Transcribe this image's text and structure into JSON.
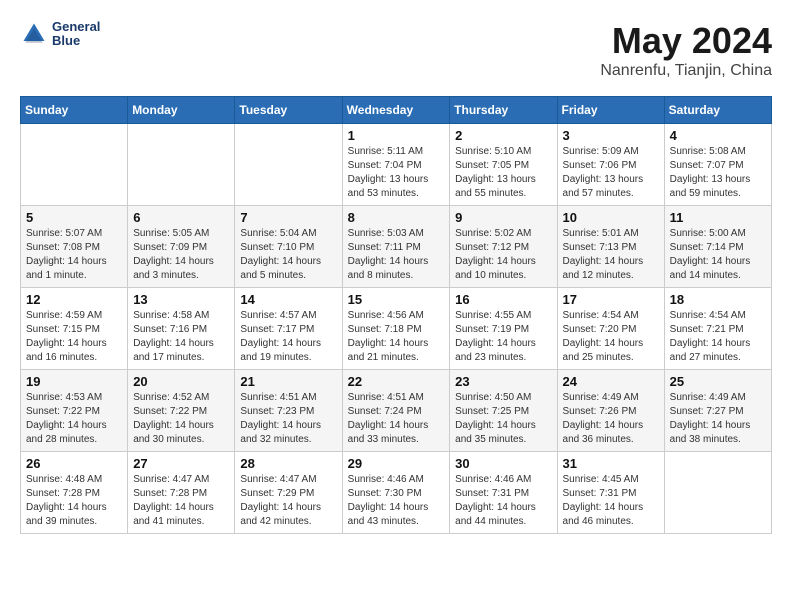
{
  "header": {
    "logo_line1": "General",
    "logo_line2": "Blue",
    "month": "May 2024",
    "location": "Nanrenfu, Tianjin, China"
  },
  "weekdays": [
    "Sunday",
    "Monday",
    "Tuesday",
    "Wednesday",
    "Thursday",
    "Friday",
    "Saturday"
  ],
  "weeks": [
    [
      {
        "day": "",
        "info": ""
      },
      {
        "day": "",
        "info": ""
      },
      {
        "day": "",
        "info": ""
      },
      {
        "day": "1",
        "info": "Sunrise: 5:11 AM\nSunset: 7:04 PM\nDaylight: 13 hours\nand 53 minutes."
      },
      {
        "day": "2",
        "info": "Sunrise: 5:10 AM\nSunset: 7:05 PM\nDaylight: 13 hours\nand 55 minutes."
      },
      {
        "day": "3",
        "info": "Sunrise: 5:09 AM\nSunset: 7:06 PM\nDaylight: 13 hours\nand 57 minutes."
      },
      {
        "day": "4",
        "info": "Sunrise: 5:08 AM\nSunset: 7:07 PM\nDaylight: 13 hours\nand 59 minutes."
      }
    ],
    [
      {
        "day": "5",
        "info": "Sunrise: 5:07 AM\nSunset: 7:08 PM\nDaylight: 14 hours\nand 1 minute."
      },
      {
        "day": "6",
        "info": "Sunrise: 5:05 AM\nSunset: 7:09 PM\nDaylight: 14 hours\nand 3 minutes."
      },
      {
        "day": "7",
        "info": "Sunrise: 5:04 AM\nSunset: 7:10 PM\nDaylight: 14 hours\nand 5 minutes."
      },
      {
        "day": "8",
        "info": "Sunrise: 5:03 AM\nSunset: 7:11 PM\nDaylight: 14 hours\nand 8 minutes."
      },
      {
        "day": "9",
        "info": "Sunrise: 5:02 AM\nSunset: 7:12 PM\nDaylight: 14 hours\nand 10 minutes."
      },
      {
        "day": "10",
        "info": "Sunrise: 5:01 AM\nSunset: 7:13 PM\nDaylight: 14 hours\nand 12 minutes."
      },
      {
        "day": "11",
        "info": "Sunrise: 5:00 AM\nSunset: 7:14 PM\nDaylight: 14 hours\nand 14 minutes."
      }
    ],
    [
      {
        "day": "12",
        "info": "Sunrise: 4:59 AM\nSunset: 7:15 PM\nDaylight: 14 hours\nand 16 minutes."
      },
      {
        "day": "13",
        "info": "Sunrise: 4:58 AM\nSunset: 7:16 PM\nDaylight: 14 hours\nand 17 minutes."
      },
      {
        "day": "14",
        "info": "Sunrise: 4:57 AM\nSunset: 7:17 PM\nDaylight: 14 hours\nand 19 minutes."
      },
      {
        "day": "15",
        "info": "Sunrise: 4:56 AM\nSunset: 7:18 PM\nDaylight: 14 hours\nand 21 minutes."
      },
      {
        "day": "16",
        "info": "Sunrise: 4:55 AM\nSunset: 7:19 PM\nDaylight: 14 hours\nand 23 minutes."
      },
      {
        "day": "17",
        "info": "Sunrise: 4:54 AM\nSunset: 7:20 PM\nDaylight: 14 hours\nand 25 minutes."
      },
      {
        "day": "18",
        "info": "Sunrise: 4:54 AM\nSunset: 7:21 PM\nDaylight: 14 hours\nand 27 minutes."
      }
    ],
    [
      {
        "day": "19",
        "info": "Sunrise: 4:53 AM\nSunset: 7:22 PM\nDaylight: 14 hours\nand 28 minutes."
      },
      {
        "day": "20",
        "info": "Sunrise: 4:52 AM\nSunset: 7:22 PM\nDaylight: 14 hours\nand 30 minutes."
      },
      {
        "day": "21",
        "info": "Sunrise: 4:51 AM\nSunset: 7:23 PM\nDaylight: 14 hours\nand 32 minutes."
      },
      {
        "day": "22",
        "info": "Sunrise: 4:51 AM\nSunset: 7:24 PM\nDaylight: 14 hours\nand 33 minutes."
      },
      {
        "day": "23",
        "info": "Sunrise: 4:50 AM\nSunset: 7:25 PM\nDaylight: 14 hours\nand 35 minutes."
      },
      {
        "day": "24",
        "info": "Sunrise: 4:49 AM\nSunset: 7:26 PM\nDaylight: 14 hours\nand 36 minutes."
      },
      {
        "day": "25",
        "info": "Sunrise: 4:49 AM\nSunset: 7:27 PM\nDaylight: 14 hours\nand 38 minutes."
      }
    ],
    [
      {
        "day": "26",
        "info": "Sunrise: 4:48 AM\nSunset: 7:28 PM\nDaylight: 14 hours\nand 39 minutes."
      },
      {
        "day": "27",
        "info": "Sunrise: 4:47 AM\nSunset: 7:28 PM\nDaylight: 14 hours\nand 41 minutes."
      },
      {
        "day": "28",
        "info": "Sunrise: 4:47 AM\nSunset: 7:29 PM\nDaylight: 14 hours\nand 42 minutes."
      },
      {
        "day": "29",
        "info": "Sunrise: 4:46 AM\nSunset: 7:30 PM\nDaylight: 14 hours\nand 43 minutes."
      },
      {
        "day": "30",
        "info": "Sunrise: 4:46 AM\nSunset: 7:31 PM\nDaylight: 14 hours\nand 44 minutes."
      },
      {
        "day": "31",
        "info": "Sunrise: 4:45 AM\nSunset: 7:31 PM\nDaylight: 14 hours\nand 46 minutes."
      },
      {
        "day": "",
        "info": ""
      }
    ]
  ]
}
